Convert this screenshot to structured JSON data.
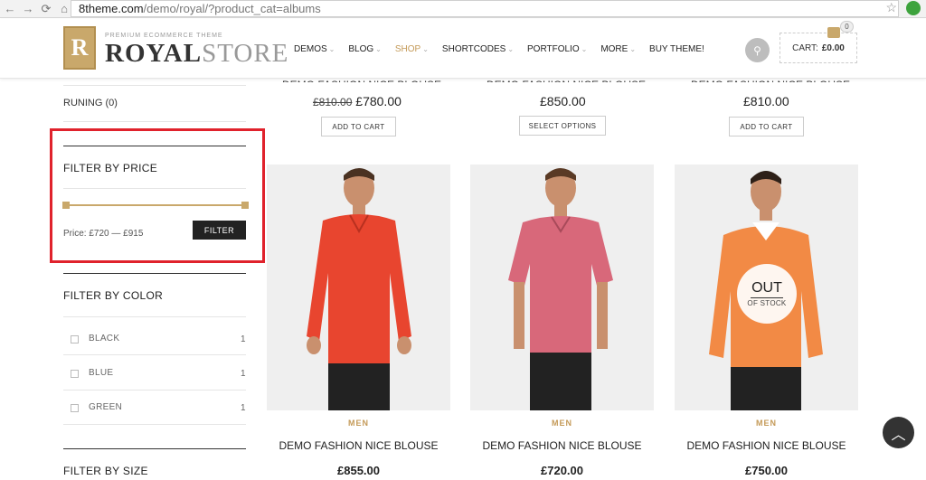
{
  "browser": {
    "url_host": "8theme.com",
    "url_path": "/demo/royal/?product_cat=albums"
  },
  "header": {
    "logo_letter": "R",
    "logo_tagline": "PREMIUM ECOMMERCE THEME",
    "logo_royal": "ROYAL",
    "logo_store": "STORE",
    "menu": [
      {
        "label": "DEMOS",
        "chev": "⌄"
      },
      {
        "label": "BLOG",
        "chev": "⌄"
      },
      {
        "label": "SHOP",
        "chev": "⌄"
      },
      {
        "label": "SHORTCODES",
        "chev": "⌄"
      },
      {
        "label": "PORTFOLIO",
        "chev": "⌄"
      },
      {
        "label": "MORE",
        "chev": "⌄"
      },
      {
        "label": "BUY THEME!",
        "chev": ""
      }
    ],
    "cart_label": "CART:",
    "cart_total": "£0.00",
    "cart_count": "0",
    "accent": "#c49a58"
  },
  "sidebar": {
    "running": "RUNING (0)",
    "price_filter": {
      "title": "FILTER BY PRICE",
      "range_text": "Price: £720 — £915",
      "button": "FILTER"
    },
    "color_filter": {
      "title": "FILTER BY COLOR",
      "items": [
        {
          "label": "BLACK",
          "count": "1"
        },
        {
          "label": "BLUE",
          "count": "1"
        },
        {
          "label": "GREEN",
          "count": "1"
        }
      ]
    },
    "size_title": "FILTER BY SIZE"
  },
  "top_row": [
    {
      "title": "DEMO FASHION NICE BLOUSE",
      "old_price": "£810.00",
      "price": "£780.00",
      "button": "ADD TO CART"
    },
    {
      "title": "DEMO FASHION NICE BLOUSE",
      "old_price": "",
      "price": "£850.00",
      "button": "SELECT OPTIONS"
    },
    {
      "title": "DEMO FASHION NICE BLOUSE",
      "old_price": "",
      "price": "£810.00",
      "button": "ADD TO CART"
    }
  ],
  "products": [
    {
      "category": "MEN",
      "name": "DEMO FASHION NICE BLOUSE",
      "price": "£855.00",
      "shirt_color": "#e8452f"
    },
    {
      "category": "MEN",
      "name": "DEMO FASHION NICE BLOUSE",
      "price": "£720.00",
      "shirt_color": "#d8687a"
    },
    {
      "category": "MEN",
      "name": "DEMO FASHION NICE BLOUSE",
      "price": "£750.00",
      "shirt_color": "#f28a45"
    }
  ],
  "out_of_stock": {
    "big": "OUT",
    "small": "OF STOCK"
  }
}
